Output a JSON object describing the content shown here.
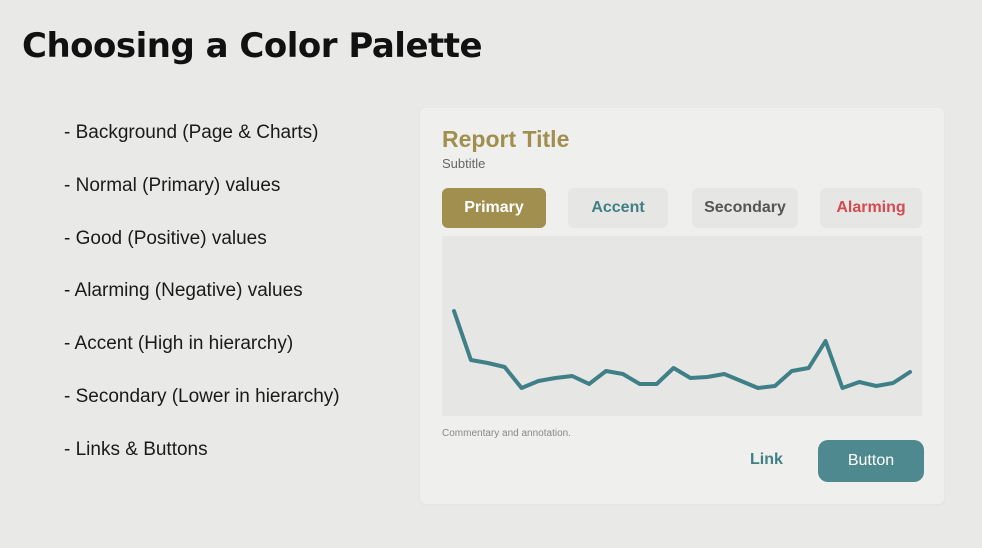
{
  "slide": {
    "title": "Choosing a Color Palette",
    "bullets": [
      "- Background (Page & Charts)",
      "- Normal (Primary) values",
      "- Good (Positive) values",
      "- Alarming (Negative) values",
      "- Accent (High in hierarchy)",
      "- Secondary (Lower in hierarchy)",
      "- Links & Buttons"
    ]
  },
  "report": {
    "title": "Report Title",
    "subtitle": "Subtitle",
    "pills": {
      "primary": "Primary",
      "accent": "Accent",
      "secondary": "Secondary",
      "alarming": "Alarming"
    },
    "commentary": "Commentary and annotation.",
    "link_label": "Link",
    "button_label": "Button"
  },
  "colors": {
    "background": "#e9e9e7",
    "card": "#efefed",
    "primary": "#a18f4f",
    "accent": "#3f7f86",
    "secondary": "#555555",
    "alarming": "#d34a50",
    "button": "#4f8990",
    "line": "#3f8088"
  },
  "chart_data": {
    "type": "line",
    "x": [
      1,
      2,
      3,
      4,
      5,
      6,
      7,
      8,
      9,
      10,
      11,
      12,
      13,
      14,
      15,
      16,
      17,
      18,
      19,
      20,
      21,
      22,
      23,
      24,
      25,
      26,
      27,
      28
    ],
    "series": [
      {
        "values": [
          85,
          36,
          33,
          29,
          8,
          15,
          18,
          20,
          12,
          25,
          22,
          12,
          12,
          28,
          18,
          19,
          22,
          15,
          8,
          10,
          25,
          28,
          55,
          8,
          14,
          10,
          13,
          24
        ]
      }
    ],
    "ylim": [
      0,
      100
    ]
  }
}
